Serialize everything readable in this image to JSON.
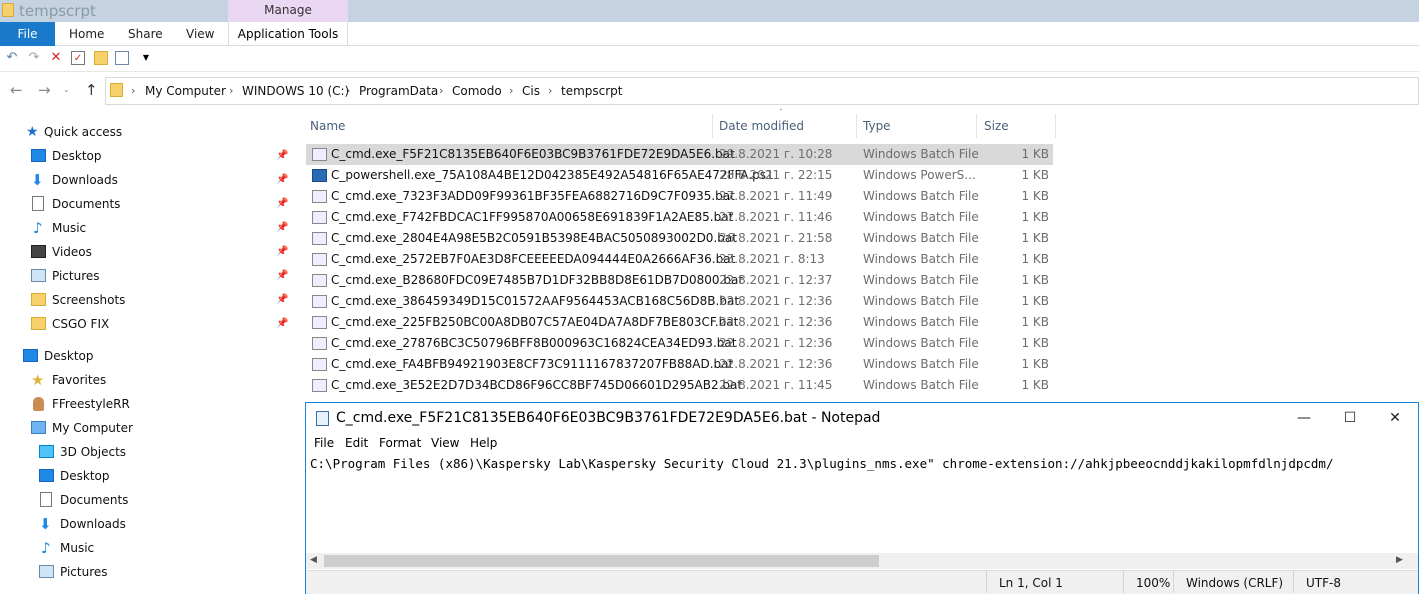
{
  "window": {
    "title": "tempscrpt"
  },
  "ribbon": {
    "context_tab": "Manage",
    "file_tab": "File",
    "tabs": [
      "Home",
      "Share",
      "View"
    ],
    "app_tools": "Application Tools"
  },
  "nav": {
    "back": "←",
    "forward": "→",
    "up": "↑",
    "path": [
      "My Computer",
      "WINDOWS 10 (C:)",
      "ProgramData",
      "Comodo",
      "Cis",
      "tempscrpt"
    ]
  },
  "sidebar": {
    "quick_access": "Quick access",
    "pinned": [
      "Desktop",
      "Downloads",
      "Documents",
      "Music",
      "Videos",
      "Pictures",
      "Screenshots",
      "CSGO FIX"
    ],
    "desktop": "Desktop",
    "favorites": "Favorites",
    "user": "FFreestyleRR",
    "my_computer": "My Computer",
    "pc_items": [
      "3D Objects",
      "Desktop",
      "Documents",
      "Downloads",
      "Music",
      "Pictures"
    ]
  },
  "columns": {
    "name": "Name",
    "date": "Date modified",
    "type": "Type",
    "size": "Size"
  },
  "files": [
    {
      "name": "C_cmd.exe_F5F21C8135EB640F6E03BC9B3761FDE72E9DA5E6.bat",
      "date": "29.8.2021 г. 10:28",
      "type": "Windows Batch File",
      "size": "1 KB"
    },
    {
      "name": "C_powershell.exe_75A108A4BE12D042385E492A54816F65AE472FFA.ps1",
      "date": "28.8.2021 г. 22:15",
      "type": "Windows PowerS...",
      "size": "1 KB"
    },
    {
      "name": "C_cmd.exe_7323F3ADD09F99361BF35FEA6882716D9C7F0935.bat",
      "date": "27.8.2021 г. 11:49",
      "type": "Windows Batch File",
      "size": "1 KB"
    },
    {
      "name": "C_cmd.exe_F742FBDCAC1FF995870A00658E691839F1A2AE85.bat",
      "date": "27.8.2021 г. 11:46",
      "type": "Windows Batch File",
      "size": "1 KB"
    },
    {
      "name": "C_cmd.exe_2804E4A98E5B2C0591B5398E4BAC5050893002D0.bat",
      "date": "26.8.2021 г. 21:58",
      "type": "Windows Batch File",
      "size": "1 KB"
    },
    {
      "name": "C_cmd.exe_2572EB7F0AE3D8FCEEEEEDA094444E0A2666AF36.bat",
      "date": "23.8.2021 г. 8:13",
      "type": "Windows Batch File",
      "size": "1 KB"
    },
    {
      "name": "C_cmd.exe_B28680FDC09E7485B7D1DF32BB8D8E61DB7D0800.bat",
      "date": "22.8.2021 г. 12:37",
      "type": "Windows Batch File",
      "size": "1 KB"
    },
    {
      "name": "C_cmd.exe_386459349D15C01572AAF9564453ACB168C56D8B.bat",
      "date": "22.8.2021 г. 12:36",
      "type": "Windows Batch File",
      "size": "1 KB"
    },
    {
      "name": "C_cmd.exe_225FB250BC00A8DB07C57AE04DA7A8DF7BE803CF.bat",
      "date": "22.8.2021 г. 12:36",
      "type": "Windows Batch File",
      "size": "1 KB"
    },
    {
      "name": "C_cmd.exe_27876BC3C50796BFF8B000963C16824CEA34ED93.bat",
      "date": "22.8.2021 г. 12:36",
      "type": "Windows Batch File",
      "size": "1 KB"
    },
    {
      "name": "C_cmd.exe_FA4BFB94921903E8CF73C9111167837207FB88AD.bat",
      "date": "22.8.2021 г. 12:36",
      "type": "Windows Batch File",
      "size": "1 KB"
    },
    {
      "name": "C_cmd.exe_3E52E2D7D34BCD86F96CC8BF745D06601D295AB2.bat",
      "date": "22.8.2021 г. 11:45",
      "type": "Windows Batch File",
      "size": "1 KB"
    }
  ],
  "notepad": {
    "title": "C_cmd.exe_F5F21C8135EB640F6E03BC9B3761FDE72E9DA5E6.bat - Notepad",
    "menu": [
      "File",
      "Edit",
      "Format",
      "View",
      "Help"
    ],
    "content": "C:\\Program Files (x86)\\Kaspersky Lab\\Kaspersky Security Cloud 21.3\\plugins_nms.exe\" chrome-extension://ahkjpbeeocnddjkakilopmfdlnjdpcdm/",
    "status": {
      "position": "Ln 1, Col 1",
      "zoom": "100%",
      "line_endings": "Windows (CRLF)",
      "encoding": "UTF-8"
    }
  }
}
